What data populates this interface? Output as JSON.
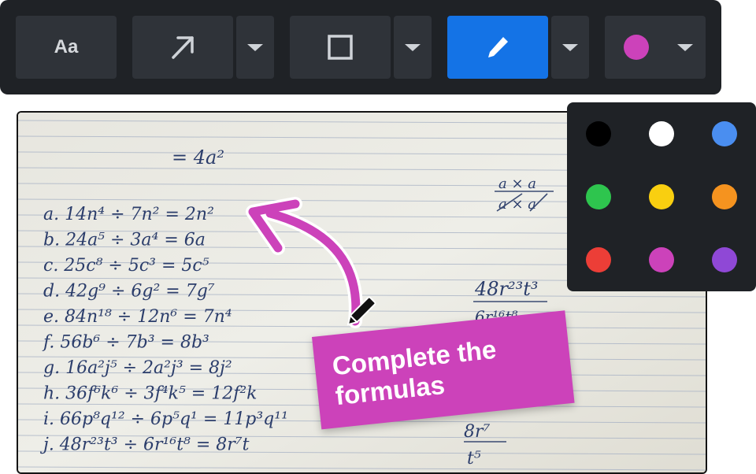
{
  "toolbar": {
    "text_tool_label": "Aa",
    "tools": [
      {
        "name": "text",
        "icon": "text-aa-icon"
      },
      {
        "name": "arrow",
        "icon": "arrow-up-right-icon"
      },
      {
        "name": "rectangle",
        "icon": "square-outline-icon"
      },
      {
        "name": "pen",
        "icon": "pen-icon",
        "active": true
      },
      {
        "name": "color",
        "icon": "color-swatch-icon"
      }
    ],
    "active_tool": "pen",
    "current_color": "#cc42ba",
    "active_color": "#1473e6"
  },
  "callout": {
    "text": "Complete the formulas",
    "color": "#cc42ba"
  },
  "palette": {
    "colors": [
      {
        "name": "black",
        "hex": "#000000"
      },
      {
        "name": "white",
        "hex": "#ffffff"
      },
      {
        "name": "blue",
        "hex": "#4a8ef0"
      },
      {
        "name": "green",
        "hex": "#2ec54e"
      },
      {
        "name": "yellow",
        "hex": "#f9cf10"
      },
      {
        "name": "orange",
        "hex": "#f5931f"
      },
      {
        "name": "red",
        "hex": "#ec3e37"
      },
      {
        "name": "magenta",
        "hex": "#cc42ba"
      },
      {
        "name": "purple",
        "hex": "#8f48d6"
      }
    ]
  },
  "notebook": {
    "header": "= 4a²",
    "lines": [
      "a. 14n⁴ ÷ 7n² = 2n²",
      "b. 24a⁵ ÷ 3a⁴ = 6a",
      "c. 25c⁸ ÷ 5c³ = 5c⁵",
      "d. 42g⁹ ÷ 6g² = 7g⁷",
      "e. 84n¹⁸ ÷ 12n⁶ = 7n⁴",
      "f. 56b⁶ ÷ 7b³ = 8b³",
      "g. 16a²j⁵ ÷ 2a²j³ = 8j²",
      "h. 36f⁶k⁶ ÷ 3f⁴k⁵ = 12f²k",
      "i. 66p⁸q¹² ÷ 6p⁵q¹ = 11p³q¹¹",
      "j. 48r²³t³ ÷ 6r¹⁶t⁸ = 8r⁷t"
    ],
    "side_fraction_top": "a × a",
    "side_fraction_bottom": "a × a",
    "side_work_top": "48r²³t³",
    "side_work_bottom": "6r¹⁶t⁸",
    "side_result_top": "8r⁷",
    "side_result_bottom": "t⁵"
  }
}
